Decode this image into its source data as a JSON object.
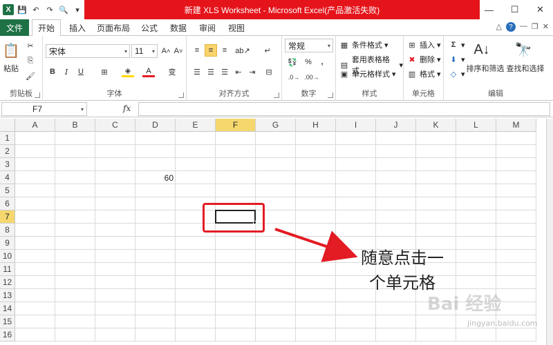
{
  "window": {
    "title": "新建 XLS Worksheet - Microsoft Excel(产品激活失败)",
    "minimize": "—",
    "maximize": "☐",
    "close": "✕"
  },
  "tabs": [
    "文件",
    "开始",
    "插入",
    "页面布局",
    "公式",
    "数据",
    "审阅",
    "视图"
  ],
  "ribbon": {
    "clipboard": {
      "label": "剪贴板",
      "paste": "粘贴"
    },
    "font": {
      "label": "字体",
      "name": "宋体",
      "size": "11",
      "bold": "B",
      "italic": "I",
      "underline": "U"
    },
    "alignment": {
      "label": "对齐方式"
    },
    "number": {
      "label": "数字",
      "format": "常规",
      "percent": "%",
      "comma": ","
    },
    "styles": {
      "label": "样式",
      "cond_format": "条件格式",
      "table_format": "套用表格格式",
      "cell_styles": "单元格样式"
    },
    "cells": {
      "label": "单元格",
      "insert": "插入",
      "delete": "删除",
      "format": "格式"
    },
    "editing": {
      "label": "编辑",
      "sum": "Σ",
      "sort_filter": "排序和筛选",
      "find_select": "查找和选择"
    }
  },
  "formula_bar": {
    "name_box": "F7",
    "fx": "fx",
    "value": ""
  },
  "grid": {
    "columns": [
      "A",
      "B",
      "C",
      "D",
      "E",
      "F",
      "G",
      "H",
      "I",
      "J",
      "K",
      "L",
      "M"
    ],
    "rows": [
      "1",
      "2",
      "3",
      "4",
      "5",
      "6",
      "7",
      "8",
      "9",
      "10",
      "11",
      "12",
      "13",
      "14",
      "15",
      "16"
    ],
    "selected_column": "F",
    "selected_row": "7",
    "cells": {
      "D4": "60"
    }
  },
  "annotation": {
    "line1": "随意点击一",
    "line2": "个单元格",
    "color": "#e31b23"
  },
  "watermark": {
    "text": "Bai 经验",
    "sub": "jingyan.baidu.com"
  }
}
